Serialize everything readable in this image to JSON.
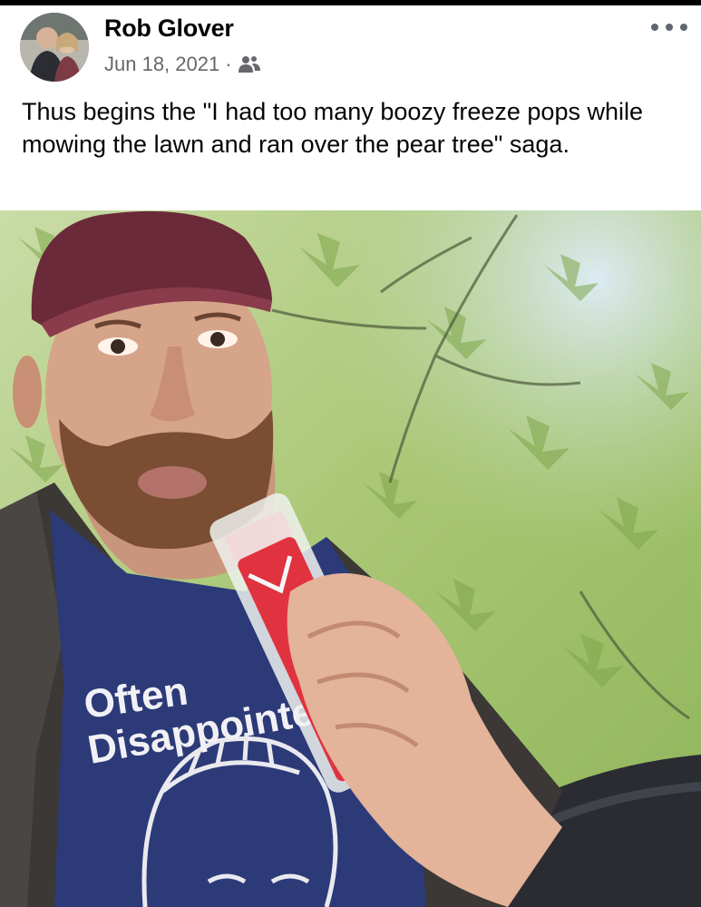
{
  "post": {
    "author": "Rob Glover",
    "date": "Jun 18, 2021",
    "separator": "·",
    "audience_icon": "friends-icon",
    "more_icon": "more-options-icon",
    "text": "Thus begins the \"I had too many boozy freeze pops while mowing the lawn and ran over the pear tree\" saga."
  },
  "photo": {
    "shirt_text_line1": "Often",
    "shirt_text_line2": "Disappointed"
  },
  "colors": {
    "text_primary": "#050505",
    "text_secondary": "#65676b",
    "foliage": "#a9c97a",
    "sky": "#cfe3ef",
    "shirt": "#2d3a78",
    "cap": "#6b2a3a",
    "freeze_pop": "#e0323f"
  }
}
